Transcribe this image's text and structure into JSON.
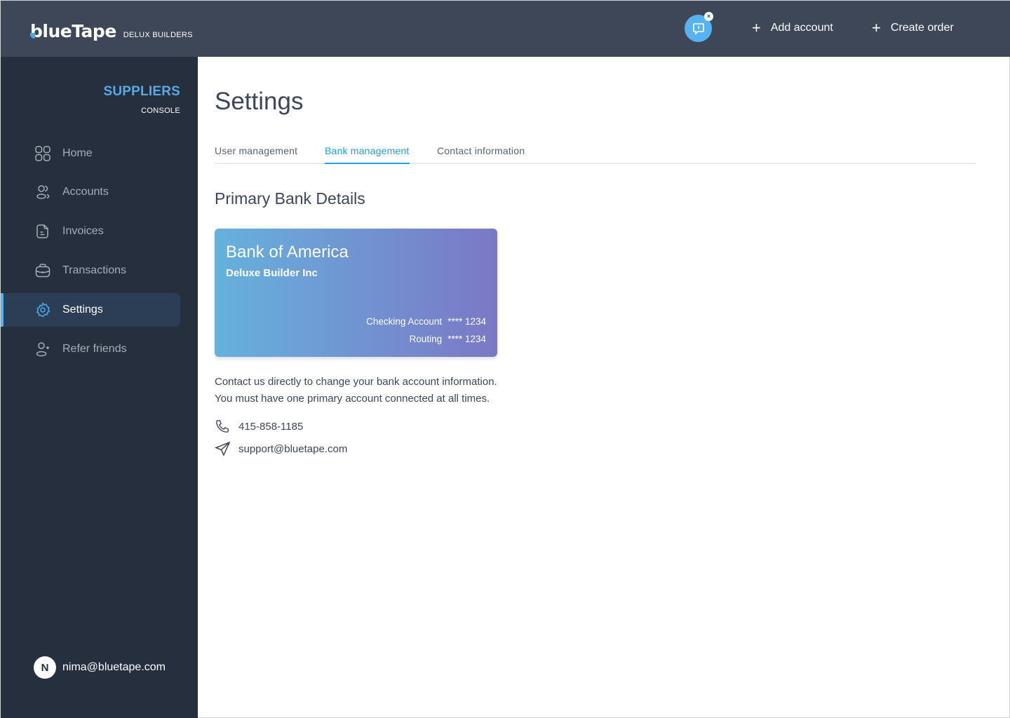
{
  "header": {
    "logo_text": "bluetape",
    "company": "DELUX BUILDERS",
    "alert_icon": "chat-alert-icon",
    "actions": [
      {
        "label": "Add account",
        "icon": "plus-icon"
      },
      {
        "label": "Create order",
        "icon": "plus-icon"
      }
    ]
  },
  "sidebar": {
    "title": "SUPPLIERS",
    "subtitle": "CONSOLE",
    "items": [
      {
        "label": "Home",
        "icon": "grid-icon",
        "active": false
      },
      {
        "label": "Accounts",
        "icon": "users-icon",
        "active": false
      },
      {
        "label": "Invoices",
        "icon": "document-icon",
        "active": false
      },
      {
        "label": "Transactions",
        "icon": "briefcase-icon",
        "active": false
      },
      {
        "label": "Settings",
        "icon": "gear-icon",
        "active": true
      },
      {
        "label": "Refer friends",
        "icon": "user-plus-icon",
        "active": false
      }
    ],
    "user": {
      "initial": "N",
      "email": "nima@bluetape.com"
    }
  },
  "main": {
    "title": "Settings",
    "tabs": [
      {
        "label": "User management",
        "active": false
      },
      {
        "label": "Bank management",
        "active": true
      },
      {
        "label": "Contact information",
        "active": false
      }
    ],
    "section_title": "Primary Bank Details",
    "card": {
      "bank_name": "Bank of America",
      "holder": "Deluxe Builder Inc",
      "checking_label": "Checking Account",
      "checking_value": "**** 1234",
      "routing_label": "Routing",
      "routing_value": "**** 1234"
    },
    "info_line1": "Contact us directly to change your bank account information.",
    "info_line2": "You must have one primary account connected at all times.",
    "phone": "415-858-1185",
    "email": "support@bluetape.com"
  },
  "colors": {
    "accent": "#1da0e6",
    "topbar": "#3d4757",
    "sidebar": "#262f3e",
    "card_gradient_start": "#66b1dd",
    "card_gradient_end": "#7b78c6"
  }
}
